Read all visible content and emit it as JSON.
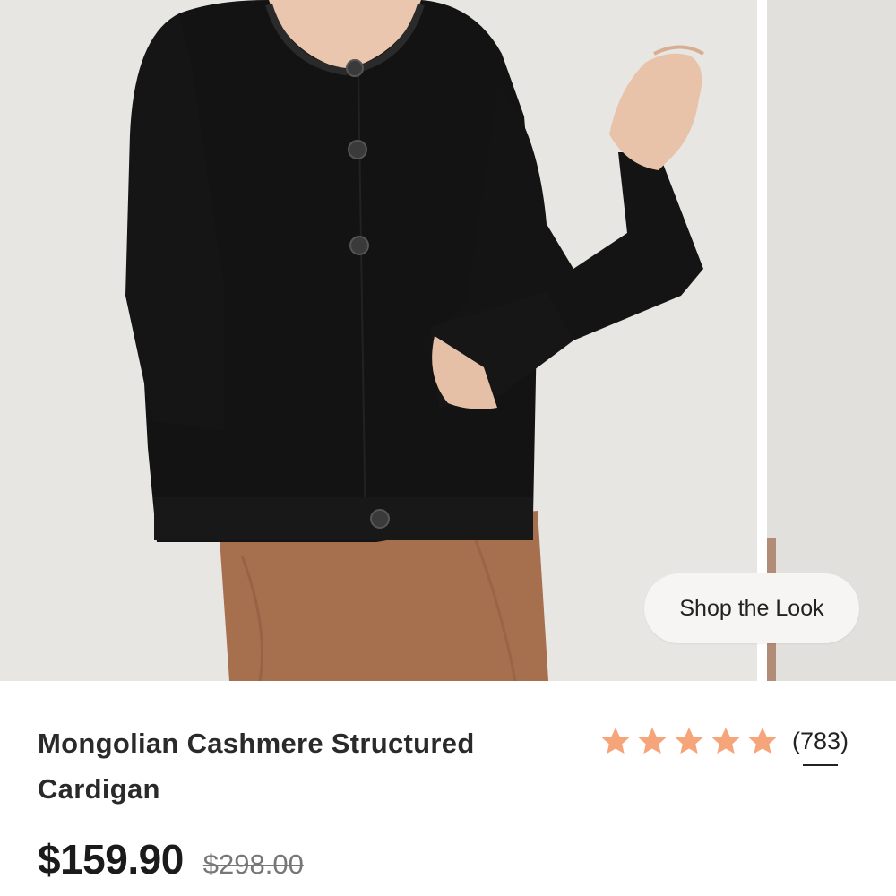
{
  "gallery": {
    "shop_the_look_label": "Shop the Look",
    "main_image_alt": "model-wearing-black-cardigan-and-brown-leather-skirt"
  },
  "product": {
    "title": "Mongolian Cashmere Structured Cardigan",
    "rating_stars": 5,
    "review_count": "(783)",
    "price_current": "$159.90",
    "price_original": "$298.00"
  },
  "colors": {
    "star": "#f6a47a",
    "background_photo": "#e9e7e4",
    "cardigan": "#121212",
    "skirt": "#a87453"
  }
}
